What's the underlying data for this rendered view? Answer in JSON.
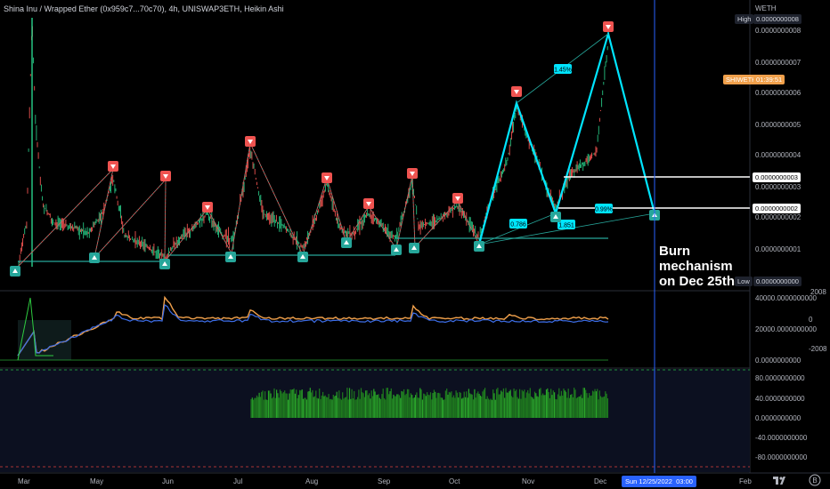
{
  "header": {
    "symbol_line": "Shina Inu / Wrapped Ether (0x959c7...70c70), 4h, UNISWAP3ETH, Heikin Ashi"
  },
  "annotation": {
    "line1": "Burn mechanism",
    "line2": "on Dec 25th"
  },
  "price_axis": {
    "currency": "WETH",
    "high_label": "High",
    "high_value": "0.0000000008",
    "low_label": "Low",
    "low_value": "0.0000000000",
    "symbol_tag": "SHIWETH",
    "symbol_tag_value": "01:39:51",
    "ticks": [
      "0.0000000008",
      "0.0000000007",
      "0.0000000006",
      "0.0000000005",
      "0.0000000004",
      "0.0000000003",
      "0.0000000002",
      "0.0000000001"
    ],
    "line_tag_upper": "0.0000000003",
    "line_tag_lower": "0.0000000002"
  },
  "indicator1_axis": {
    "ticks": [
      "40000.0000000000",
      "20000.0000000000",
      "0.0000000000"
    ],
    "right_ticks": [
      "2008",
      "0",
      "-2008"
    ]
  },
  "indicator2_axis": {
    "ticks": [
      "80.0000000000",
      "40.0000000000",
      "0.0000000000",
      "-40.0000000000",
      "-80.0000000000"
    ]
  },
  "time_axis": {
    "months": [
      "Mar",
      "May",
      "Jun",
      "Jul",
      "Aug",
      "Sep",
      "Oct",
      "Nov",
      "Dec",
      "Feb"
    ],
    "cursor_label": "Sun 12/25/2022",
    "cursor_time": "03:00"
  },
  "pattern_labels": {
    "top_pct": "1.45%",
    "mid_pct": "0.99%",
    "left_ratio": "0.786",
    "right_ratio": "1.851"
  },
  "colors": {
    "background": "#000000",
    "up": "#26a69a",
    "down": "#ef5350",
    "pattern": "#00e5ff",
    "cursor": "#2962ff",
    "price_tag": "#f0a04b"
  },
  "icons": {
    "logo": "tradingview-logo-icon",
    "settings": "chart-settings-icon"
  }
}
